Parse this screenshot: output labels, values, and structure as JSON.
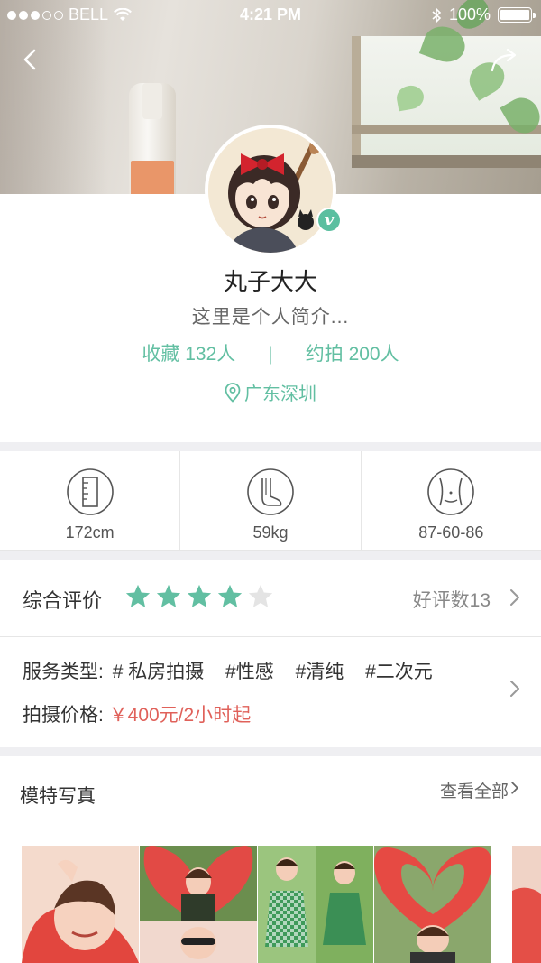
{
  "status_bar": {
    "carrier": "BELL",
    "time": "4:21 PM",
    "battery": "100%"
  },
  "profile": {
    "name": "丸子大大",
    "bio": "这里是个人简介...",
    "favorites": "收藏 132人",
    "separator": "|",
    "appointments": "约拍 200人",
    "location": "广东深圳",
    "verified_badge": "v"
  },
  "measurements": [
    {
      "icon": "height-icon",
      "value": "172cm"
    },
    {
      "icon": "foot-weight-icon",
      "value": "59kg"
    },
    {
      "icon": "body-shape-icon",
      "value": "87-60-86"
    }
  ],
  "rating": {
    "label": "综合评价",
    "stars_filled": 4,
    "stars_total": 5,
    "review_count": "好评数13"
  },
  "service": {
    "type_label": "服务类型:",
    "tags": [
      "# 私房拍摄",
      "#性感",
      "#清纯",
      "#二次元"
    ],
    "price_label": "拍摄价格:",
    "price_value": "￥400元/2小时起"
  },
  "gallery": {
    "title": "模特写真",
    "view_all": "查看全部"
  },
  "colors": {
    "accent": "#62bfa2",
    "price": "#e0615a",
    "divider": "#efeff2"
  }
}
